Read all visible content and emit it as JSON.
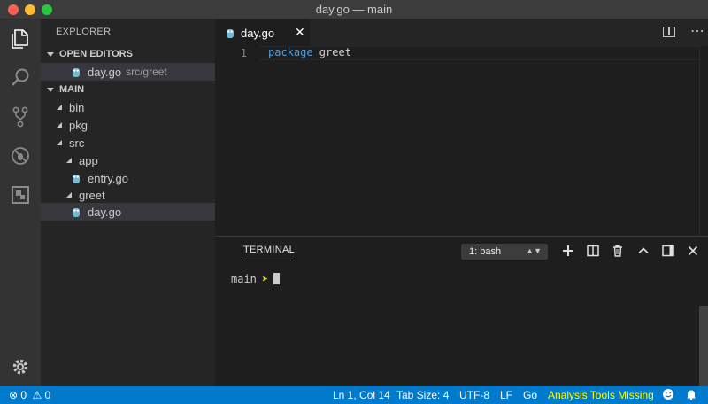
{
  "window": {
    "title": "day.go — main"
  },
  "activity_bar": {
    "items": [
      {
        "icon": "files-icon"
      },
      {
        "icon": "search-icon"
      },
      {
        "icon": "source-control-icon"
      },
      {
        "icon": "debug-icon"
      },
      {
        "icon": "extensions-icon"
      }
    ],
    "settings_icon": "gear-icon"
  },
  "sidebar": {
    "title": "EXPLORER",
    "open_editors": {
      "header": "OPEN EDITORS",
      "items": [
        {
          "name": "day.go",
          "path": "src/greet"
        }
      ]
    },
    "folder": {
      "header": "MAIN",
      "tree": [
        {
          "name": "bin"
        },
        {
          "name": "pkg"
        },
        {
          "name": "src"
        },
        {
          "name": "app"
        },
        {
          "name": "entry.go"
        },
        {
          "name": "greet"
        },
        {
          "name": "day.go"
        }
      ]
    }
  },
  "editor": {
    "tab": {
      "label": "day.go",
      "close": "✕"
    },
    "lines": [
      {
        "number": "1",
        "keyword": "package",
        "rest": " greet"
      }
    ]
  },
  "panel": {
    "title": "TERMINAL",
    "selected_terminal": "1: bash",
    "prompt_dir": "main",
    "prompt_symbol": "➤"
  },
  "status_bar": {
    "errors": "0",
    "warnings": "0",
    "position": "Ln 1, Col 14",
    "tab_size": "Tab Size: 4",
    "encoding": "UTF-8",
    "eol": "LF",
    "language": "Go",
    "analysis_warning": "Analysis Tools Missing"
  },
  "colors": {
    "status_bar": "#007acc",
    "activity_bar": "#333333",
    "sidebar": "#252526",
    "editor": "#1e1e1e",
    "keyword": "#569cd6",
    "warning_text": "#ffff00"
  }
}
